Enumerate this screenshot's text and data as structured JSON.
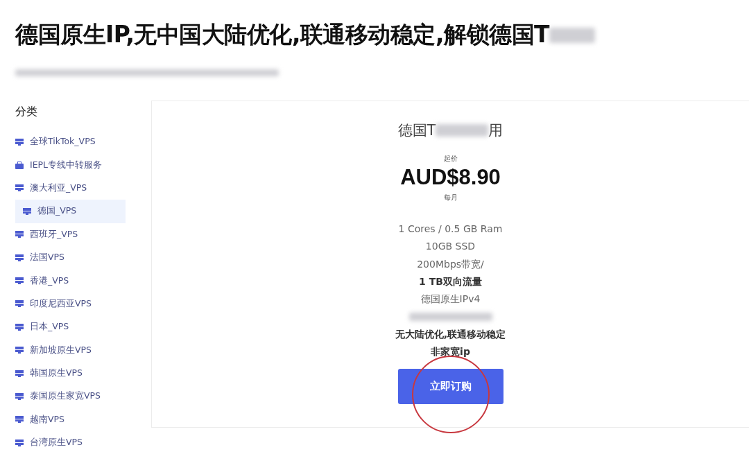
{
  "page_title": "德国原生IP,无中国大陆优化,联通移动稳定,解锁德国T",
  "sidebar": {
    "heading": "分类",
    "items": [
      {
        "label": "全球TikTok_VPS",
        "kind": "server",
        "selected": false
      },
      {
        "label": "IEPL专线中转服务",
        "kind": "bag",
        "selected": false
      },
      {
        "label": "澳大利亚_VPS",
        "kind": "server",
        "selected": false
      },
      {
        "label": "德国_VPS",
        "kind": "server",
        "selected": true
      },
      {
        "label": "西班牙_VPS",
        "kind": "server",
        "selected": false
      },
      {
        "label": "法国VPS",
        "kind": "server",
        "selected": false
      },
      {
        "label": "香港_VPS",
        "kind": "server",
        "selected": false
      },
      {
        "label": "印度尼西亚VPS",
        "kind": "server",
        "selected": false
      },
      {
        "label": "日本_VPS",
        "kind": "server",
        "selected": false
      },
      {
        "label": "新加坡原生VPS",
        "kind": "server",
        "selected": false
      },
      {
        "label": "韩国原生VPS",
        "kind": "server",
        "selected": false
      },
      {
        "label": "泰国原生家宽VPS",
        "kind": "server",
        "selected": false
      },
      {
        "label": "越南VPS",
        "kind": "server",
        "selected": false
      },
      {
        "label": "台湾原生VPS",
        "kind": "server",
        "selected": false
      }
    ]
  },
  "product": {
    "title_start": "德国T",
    "title_end": "用",
    "price_caption": "起价",
    "price": "AUD$8.90",
    "period": "每月",
    "features": [
      {
        "kind": "plain",
        "text": "1 Cores / 0.5 GB Ram"
      },
      {
        "kind": "plain",
        "text": "10GB SSD"
      },
      {
        "kind": "plain",
        "text": "200Mbps带宽/"
      },
      {
        "kind": "bold",
        "text": "1 TB双向流量"
      },
      {
        "kind": "plain",
        "text": "德国原生IPv4"
      },
      {
        "kind": "blurred"
      },
      {
        "kind": "bold",
        "text": "无大陆优化,联通移动稳定"
      },
      {
        "kind": "bold",
        "text": "非家宽ip"
      }
    ],
    "order_button": "立即订购",
    "highlight_circle": true
  }
}
